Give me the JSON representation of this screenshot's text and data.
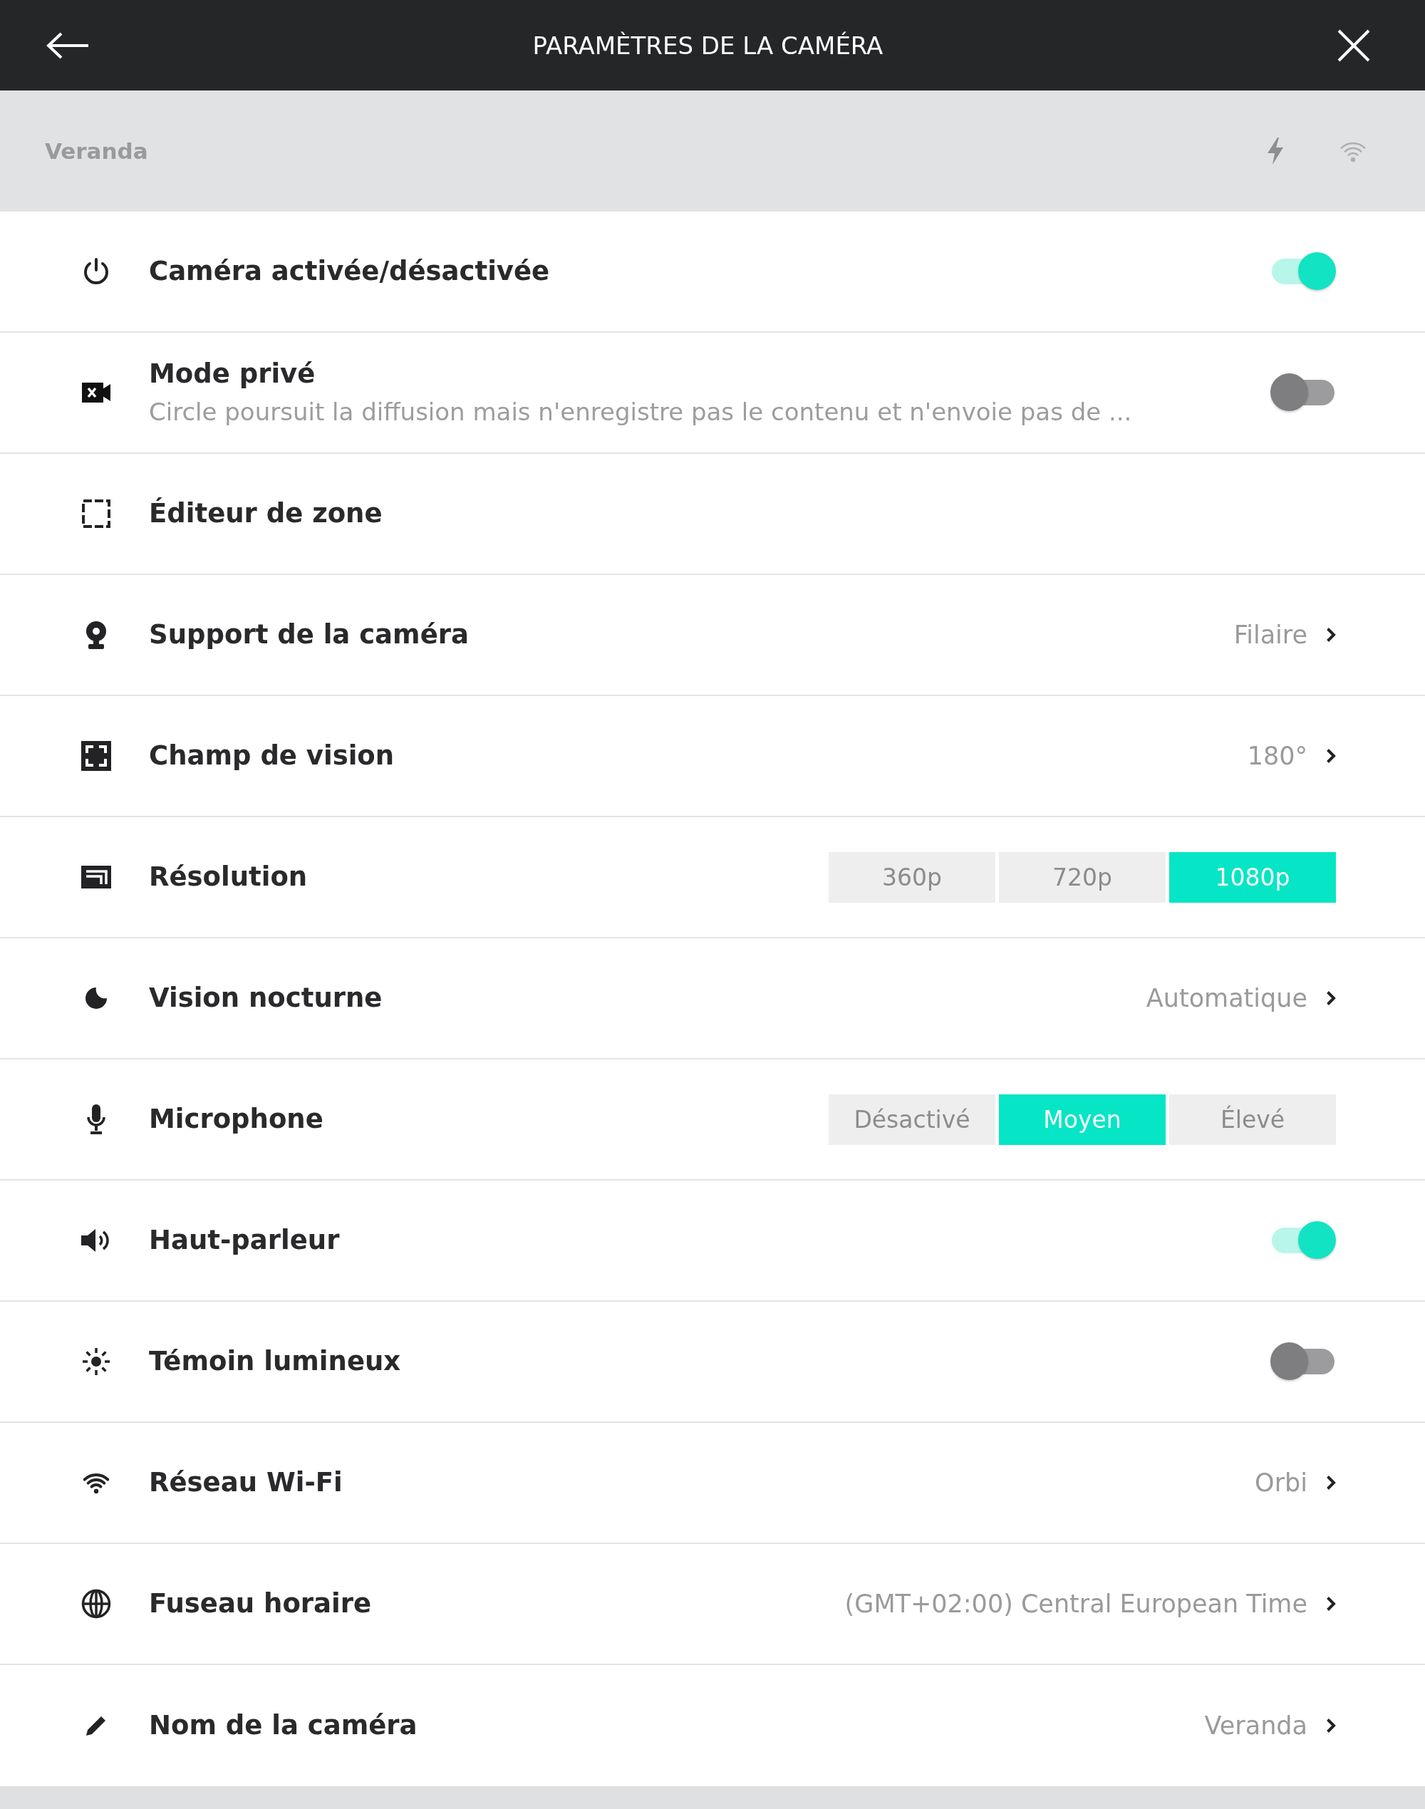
{
  "header": {
    "title": "PARAMÈTRES DE LA CAMÉRA"
  },
  "device_bar": {
    "name": "Veranda"
  },
  "settings": [
    {
      "kind": "toggle",
      "label": "Caméra activée/désactivée",
      "on": true
    },
    {
      "kind": "toggle",
      "label": "Mode privé",
      "description": "Circle poursuit la diffusion mais n'enregistre pas le contenu et n'envoie pas de ...",
      "on": false
    },
    {
      "kind": "plain",
      "label": "Éditeur de zone"
    },
    {
      "kind": "link",
      "label": "Support de la caméra",
      "value": "Filaire"
    },
    {
      "kind": "link",
      "label": "Champ de vision",
      "value": "180°"
    },
    {
      "kind": "segmented",
      "label": "Résolution",
      "options": [
        {
          "label": "360p",
          "selected": false
        },
        {
          "label": "720p",
          "selected": false
        },
        {
          "label": "1080p",
          "selected": true
        }
      ]
    },
    {
      "kind": "link",
      "label": "Vision nocturne",
      "value": "Automatique"
    },
    {
      "kind": "segmented",
      "label": "Microphone",
      "options": [
        {
          "label": "Désactivé",
          "selected": false
        },
        {
          "label": "Moyen",
          "selected": true
        },
        {
          "label": "Élevé",
          "selected": false
        }
      ]
    },
    {
      "kind": "toggle",
      "label": "Haut-parleur",
      "on": true
    },
    {
      "kind": "toggle",
      "label": "Témoin lumineux",
      "on": false
    },
    {
      "kind": "link",
      "label": "Réseau Wi-Fi",
      "value": "Orbi"
    },
    {
      "kind": "link",
      "label": "Fuseau horaire",
      "value": "(GMT+02:00) Central European Time"
    },
    {
      "kind": "link",
      "label": "Nom de la caméra",
      "value": "Veranda"
    }
  ]
}
